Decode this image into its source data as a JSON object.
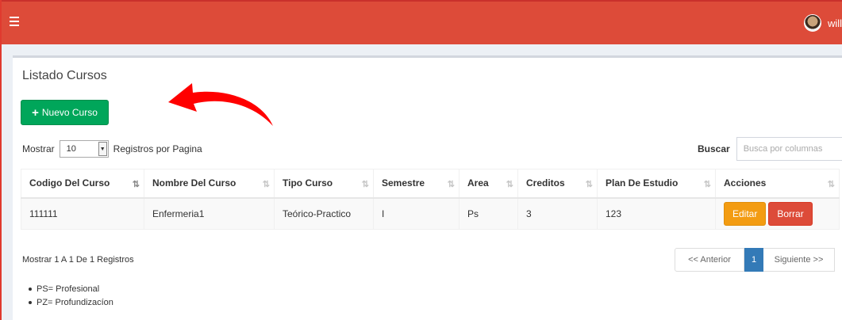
{
  "header": {
    "user_name": "willia"
  },
  "panel": {
    "title": "Listado Cursos",
    "new_button_label": "Nuevo Curso"
  },
  "length_menu": {
    "prefix": "Mostrar",
    "selected": "10",
    "suffix": "Registros por Pagina"
  },
  "search": {
    "label": "Buscar",
    "placeholder": "Busca por columnas",
    "value": ""
  },
  "table": {
    "columns": [
      "Codigo Del Curso",
      "Nombre Del Curso",
      "Tipo Curso",
      "Semestre",
      "Area",
      "Creditos",
      "Plan De Estudio",
      "Acciones"
    ],
    "rows": [
      {
        "codigo": "111111",
        "nombre": "Enfermeria1",
        "tipo": "Teórico-Practico",
        "semestre": "I",
        "area": "Ps",
        "creditos": "3",
        "plan": "123",
        "edit_label": "Editar",
        "delete_label": "Borrar"
      }
    ]
  },
  "info_text": "Mostrar 1 A 1 De 1 Registros",
  "pagination": {
    "prev": "<< Anterior",
    "current": "1",
    "next": "Siguiente >>"
  },
  "legend": [
    "PS= Profesional",
    "PZ= Profundizacíon"
  ],
  "colors": {
    "topbar": "#dd4b39",
    "success": "#00a65a",
    "warning": "#f39c12",
    "danger": "#dd4b39",
    "primary": "#337ab7",
    "annotation_arrow": "#ff0000"
  },
  "icons": {
    "menu": "hamburger-icon",
    "add": "plus-icon",
    "sort": "sort-icon",
    "sort_active": "sort-asc-icon",
    "dropdown": "caret-down-icon"
  }
}
